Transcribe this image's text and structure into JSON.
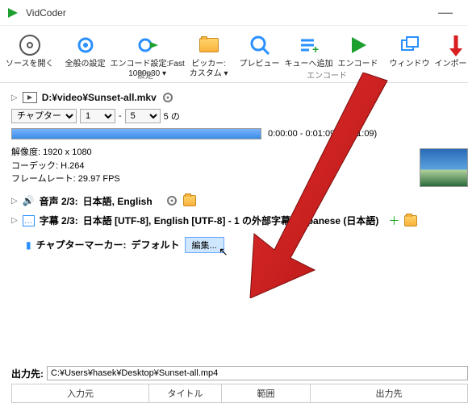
{
  "app": {
    "title": "VidCoder"
  },
  "ribbon": {
    "items": [
      {
        "name": "open-source-button",
        "label": "ソースを開く",
        "icon": "disc"
      },
      {
        "name": "global-settings-button",
        "label": "全般の設定",
        "icon": "gear"
      },
      {
        "name": "encode-settings-button",
        "label": "エンコード設定:Fast\n1080p30 ▾",
        "icon": "gear-play"
      },
      {
        "name": "picker-button",
        "label": "ピッカー:\nカスタム ▾",
        "icon": "folder"
      },
      {
        "name": "preview-button",
        "label": "プレビュー",
        "icon": "magnify"
      },
      {
        "name": "add-queue-button",
        "label": "キューへ追加",
        "icon": "list-plus"
      },
      {
        "name": "encode-button",
        "label": "エンコード",
        "icon": "play"
      },
      {
        "name": "window-button",
        "label": "ウィンドウ",
        "icon": "windows"
      },
      {
        "name": "import-button",
        "label": "インポート/",
        "icon": "down-arrow"
      }
    ],
    "group_settings": "設定",
    "group_encode": "エンコード"
  },
  "source": {
    "path": "D:¥video¥Sunset-all.mkv",
    "chapter_label": "チャプター",
    "from": "1",
    "to": "5",
    "of_suffix": "5 の",
    "prog_current": "0:00:00 - 0:01:09",
    "prog_total": "(0:01:09)",
    "res_label": "解像度:",
    "res_value": "1920 x 1080",
    "codec_label": "コーデック:",
    "codec_value": "H.264",
    "fps_label": "フレームレート:",
    "fps_value": "29.97 FPS"
  },
  "audio": {
    "label": "音声 2/3:",
    "value": "日本語, English"
  },
  "subtitle": {
    "label": "字幕 2/3:",
    "value": "日本語 [UTF-8], English [UTF-8] - 1 の外部字幕: Japanese (日本語)"
  },
  "marker": {
    "label": "チャプターマーカー:",
    "value": "デフォルト",
    "edit": "編集..."
  },
  "output": {
    "label": "出力先:",
    "path": "C:¥Users¥hasek¥Desktop¥Sunset-all.mp4",
    "cols": [
      "入力元",
      "タイトル",
      "範囲",
      "出力先"
    ]
  }
}
